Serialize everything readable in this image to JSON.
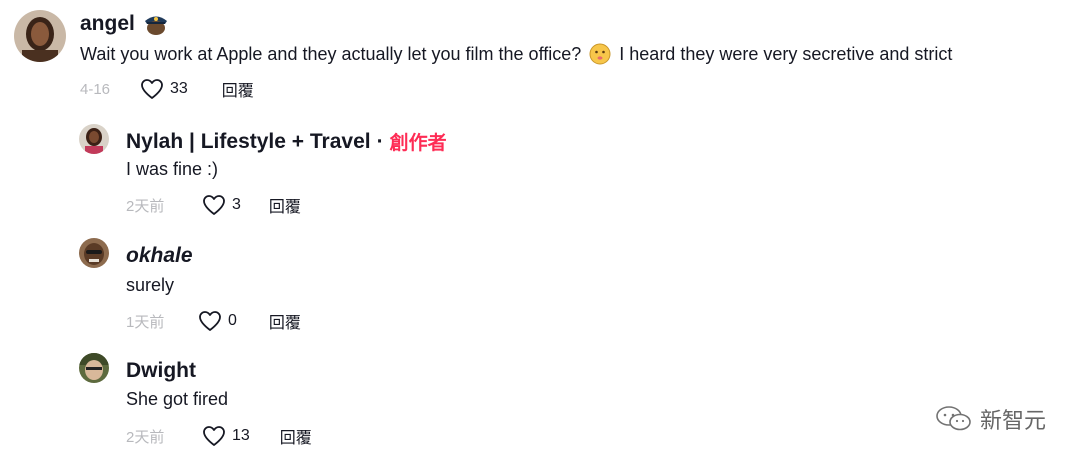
{
  "comments": [
    {
      "username": "angel",
      "badge": "police-officer-emoji",
      "text_before": "Wait you work at Apple and they actually let you film the office?",
      "emoji": "neutral-face-emoji",
      "text_after": "I heard they were very secretive and strict",
      "date": "4-16",
      "likes": "33",
      "reply_label": "回覆"
    },
    {
      "username": "Nylah | Lifestyle + Travel",
      "separator": "·",
      "creator_label": "創作者",
      "text": "I was fine :)",
      "date": "2天前",
      "likes": "3",
      "reply_label": "回覆"
    },
    {
      "username": "okhale",
      "text": "surely",
      "date": "1天前",
      "likes": "0",
      "reply_label": "回覆"
    },
    {
      "username": "Dwight",
      "text": "She got fired",
      "date": "2天前",
      "likes": "13",
      "reply_label": "回覆"
    }
  ],
  "watermark": {
    "text": "新智元",
    "icon": "wechat-icon"
  },
  "colors": {
    "creator": "#fe2c55",
    "text": "#161823",
    "muted": "#8a8b91"
  }
}
